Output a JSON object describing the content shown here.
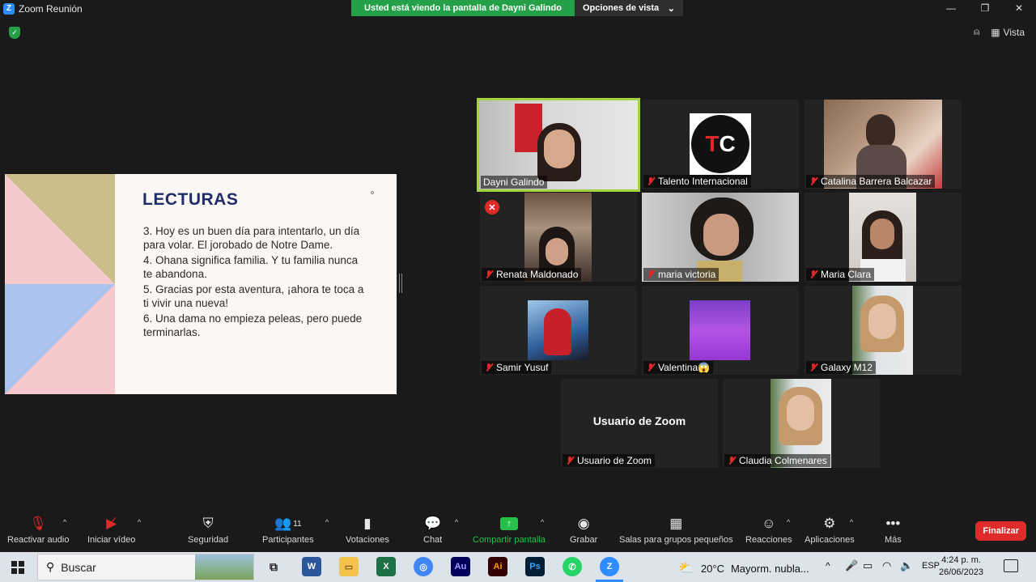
{
  "window": {
    "title": "Zoom Reunión",
    "share_banner": "Usted está viendo la pantalla de Dayni Galindo",
    "view_options": "Opciones de vista",
    "view_button": "Vista"
  },
  "slide": {
    "title": "LECTURAS",
    "lines": [
      "3. Hoy es un buen día para intentarlo, un día para volar. El jorobado de Notre Dame.",
      "4. Ohana significa familia. Y tu familia nunca te abandona.",
      "5. Gracias por esta aventura, ¡ahora te toca a ti vivir una nueva!",
      "6. Una dama no empieza peleas, pero puede terminarlas."
    ]
  },
  "participants": [
    {
      "name": "Dayni Galindo",
      "muted": false,
      "active": true
    },
    {
      "name": "Talento Internacional",
      "muted": true
    },
    {
      "name": "Catalina Barrera Balcazar",
      "muted": true
    },
    {
      "name": "Renata Maldonado",
      "muted": true
    },
    {
      "name": "maria victoria",
      "muted": true
    },
    {
      "name": "Maria Clara",
      "muted": true
    },
    {
      "name": "Samir Yusuf",
      "muted": true
    },
    {
      "name": "Valentina😱",
      "muted": true
    },
    {
      "name": "Galaxy M12",
      "muted": true
    },
    {
      "name": "Usuario de Zoom",
      "muted": true,
      "center_label": "Usuario de Zoom"
    },
    {
      "name": "Claudia Colmenares",
      "muted": true
    }
  ],
  "toolbar": {
    "audio": "Reactivar audio",
    "video": "Iniciar vídeo",
    "security": "Seguridad",
    "participants": "Participantes",
    "participants_count": "11",
    "polls": "Votaciones",
    "chat": "Chat",
    "share": "Compartir pantalla",
    "record": "Grabar",
    "breakout": "Salas para grupos pequeños",
    "reactions": "Reacciones",
    "apps": "Aplicaciones",
    "more": "Más",
    "end": "Finalizar"
  },
  "taskbar": {
    "search": "Buscar",
    "weather_temp": "20°C",
    "weather_desc": "Mayorm. nubla...",
    "lang": "ESP",
    "time": "4:24 p. m.",
    "date": "26/06/2023"
  },
  "colors": {
    "zoom_blue": "#2d8cff",
    "share_green": "#24a148",
    "active_border": "#a3d33d",
    "end_red": "#e02b2b",
    "slide_navy": "#1f2d6b"
  }
}
